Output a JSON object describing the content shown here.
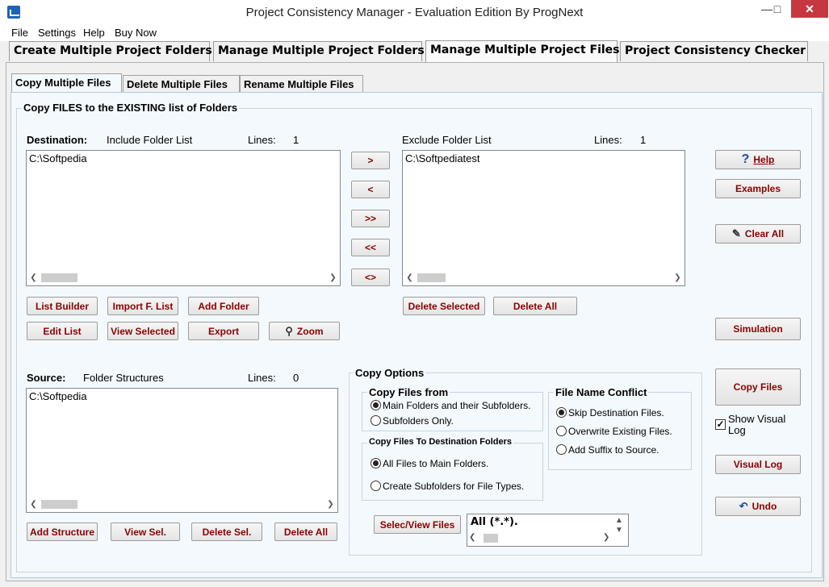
{
  "window": {
    "title": "Project Consistency Manager - Evaluation Edition  By ProgNext",
    "minimize": "—",
    "maximize": "□",
    "close": "✕"
  },
  "menu": [
    "File",
    "Settings",
    "Help",
    "Buy Now"
  ],
  "main_tabs": [
    "Create Multiple Project Folders",
    "Manage Multiple Project Folders",
    "Manage Multiple Project Files",
    "Project Consistency Checker"
  ],
  "sub_tabs": [
    "Copy Multiple Files",
    "Delete Multiple Files",
    "Rename Multiple Files"
  ],
  "group_title": "Copy FILES to the EXISTING list of Folders",
  "destination": {
    "label": "Destination:",
    "list_label": "Include Folder List",
    "lines_label": "Lines:",
    "lines": "1",
    "items": [
      "C:\\Softpedia"
    ],
    "buttons": [
      "List Builder",
      "Import F. List",
      "Add Folder",
      "Edit List",
      "View Selected",
      "Export",
      "Zoom"
    ]
  },
  "transfer_buttons": [
    ">",
    "<",
    ">>",
    "<<",
    "<>"
  ],
  "exclude": {
    "list_label": "Exclude Folder List",
    "lines_label": "Lines:",
    "lines": "1",
    "items": [
      "C:\\Softpediatest"
    ],
    "buttons": [
      "Delete Selected",
      "Delete All"
    ]
  },
  "source": {
    "label": "Source:",
    "list_label": "Folder Structures",
    "lines_label": "Lines:",
    "lines": "0",
    "items": [
      "C:\\Softpedia"
    ],
    "buttons": [
      "Add  Structure",
      "View Sel.",
      "Delete Sel.",
      "Delete All"
    ]
  },
  "copy_options": {
    "title": "Copy Options",
    "copy_from": {
      "title": "Copy Files from",
      "options": [
        "Main Folders and their Subfolders.",
        "Subfolders Only."
      ],
      "selected": 0
    },
    "to_dest": {
      "title": "Copy Files To Destination Folders",
      "options": [
        "All Files to Main  Folders.",
        "Create Subfolders for File Types."
      ],
      "selected": 0
    },
    "conflict": {
      "title": "File Name Conflict",
      "options": [
        "Skip Destination Files.",
        "Overwrite Existing Files.",
        "Add Suffix to Source."
      ],
      "selected": 0
    },
    "select_files_button": "Selec/View Files",
    "filter_value": "All (*.*)."
  },
  "side_buttons": {
    "help": "Help",
    "examples": "Examples",
    "clear_all": "Clear All",
    "simulation": "Simulation",
    "copy_files": "Copy Files",
    "show_visual_log": "Show Visual Log",
    "show_visual_log_checked": true,
    "visual_log": "Visual Log",
    "undo": "Undo"
  }
}
